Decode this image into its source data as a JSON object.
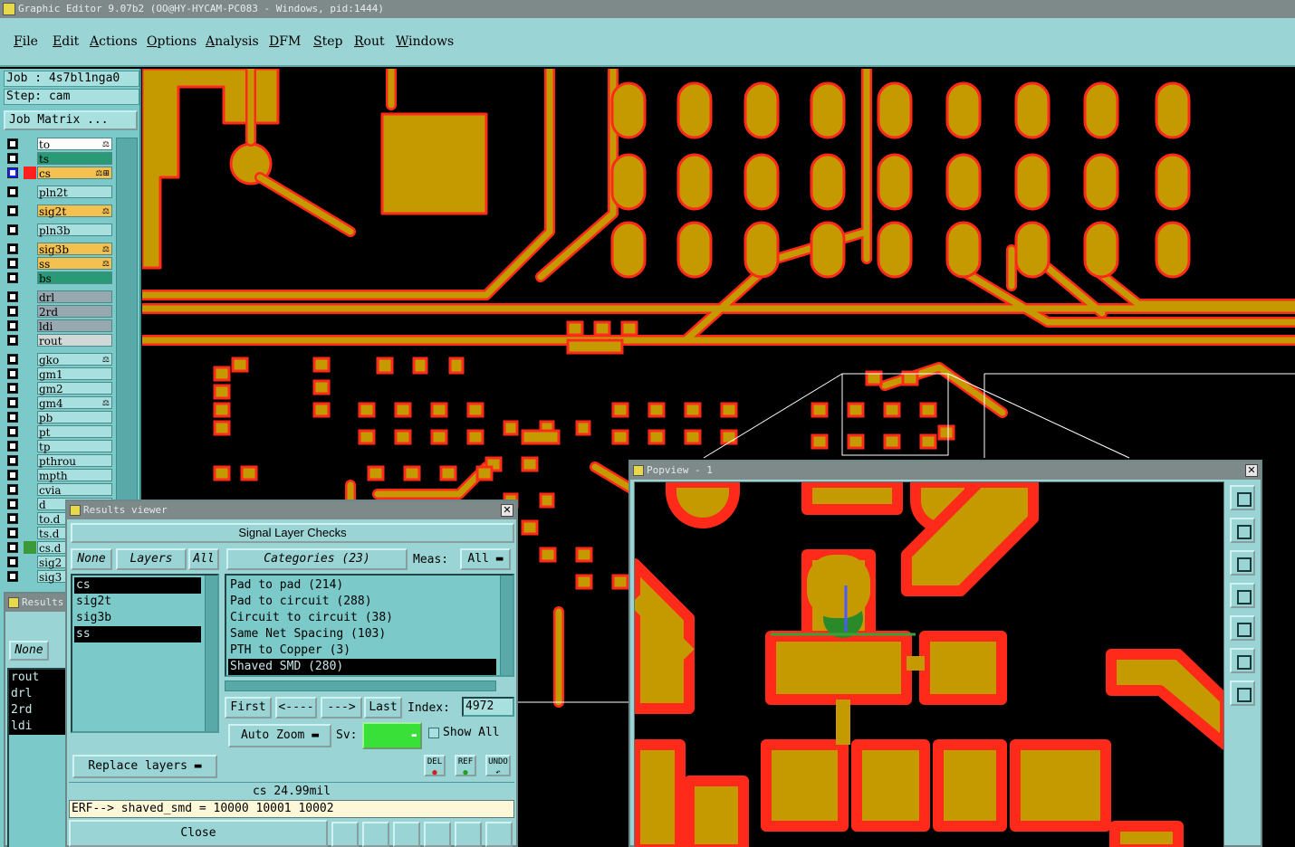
{
  "window": {
    "title": "Graphic Editor 9.07b2 (OO@HY-HYCAM-PC083 - Windows, pid:1444)"
  },
  "menu": [
    "File",
    "Edit",
    "Actions",
    "Options",
    "Analysis",
    "DFM",
    "Step",
    "Rout",
    "Windows"
  ],
  "job": {
    "job_label": "Job : 4s7bl1nga0",
    "step_label": "Step: cam",
    "matrix_button": "Job Matrix ..."
  },
  "layers": [
    {
      "name": "to",
      "color": "#ffffff",
      "icon": "⚖"
    },
    {
      "name": "ts",
      "color": "#2a9a76",
      "icon": ""
    },
    {
      "name": "cs",
      "color": "#f4c050",
      "icon": "⚖⊞",
      "active": true
    },
    {
      "name": "pln2t",
      "color": "#a8e0e0",
      "icon": ""
    },
    {
      "name": "sig2t",
      "color": "#f4c050",
      "icon": "⚖"
    },
    {
      "name": "pln3b",
      "color": "#a8e0e0",
      "icon": ""
    },
    {
      "name": "sig3b",
      "color": "#f4c050",
      "icon": "⚖"
    },
    {
      "name": "ss",
      "color": "#f4c050",
      "icon": "⚖"
    },
    {
      "name": "bs",
      "color": "#2a9a76",
      "icon": ""
    },
    {
      "name": "drl",
      "color": "#98a8b0",
      "icon": ""
    },
    {
      "name": "2rd",
      "color": "#98a8b0",
      "icon": ""
    },
    {
      "name": "ldi",
      "color": "#98a8b0",
      "icon": ""
    },
    {
      "name": "rout",
      "color": "#d0d8d8",
      "icon": ""
    },
    {
      "name": "gko",
      "color": "#a8e0e0",
      "icon": "⚖"
    },
    {
      "name": "gm1",
      "color": "#a8e0e0",
      "icon": ""
    },
    {
      "name": "gm2",
      "color": "#a8e0e0",
      "icon": ""
    },
    {
      "name": "gm4",
      "color": "#a8e0e0",
      "icon": "⚖"
    },
    {
      "name": "pb",
      "color": "#a8e0e0",
      "icon": ""
    },
    {
      "name": "pt",
      "color": "#a8e0e0",
      "icon": ""
    },
    {
      "name": "tp",
      "color": "#a8e0e0",
      "icon": ""
    },
    {
      "name": "pthrou",
      "color": "#a8e0e0",
      "icon": ""
    },
    {
      "name": "mpth",
      "color": "#a8e0e0",
      "icon": ""
    },
    {
      "name": "cvia",
      "color": "#a8e0e0",
      "icon": ""
    },
    {
      "name": "d",
      "color": "#a8e0e0",
      "icon": ""
    },
    {
      "name": "to.d",
      "color": "#a8e0e0",
      "icon": ""
    },
    {
      "name": "ts.d",
      "color": "#a8e0e0",
      "icon": ""
    },
    {
      "name": "cs.d",
      "color": "#a8e0e0",
      "icon": ""
    },
    {
      "name": "sig2",
      "color": "#a8e0e0",
      "icon": ""
    },
    {
      "name": "sig3",
      "color": "#a8e0e0",
      "icon": ""
    }
  ],
  "results_back": {
    "title": "Results",
    "none_button": "None",
    "layers": [
      "rout",
      "drl",
      "2rd",
      "ldi"
    ]
  },
  "results": {
    "title": "Results viewer",
    "heading": "Signal Layer Checks",
    "none_button": "None",
    "layers_button": "Layers",
    "all_button": "All",
    "categories_button": "Categories (23)",
    "meas_label": "Meas:",
    "meas_value": "All",
    "layers_list": [
      {
        "name": "cs",
        "selected": true
      },
      {
        "name": "sig2t",
        "selected": false
      },
      {
        "name": "sig3b",
        "selected": false
      },
      {
        "name": "ss",
        "selected": true
      }
    ],
    "categories": [
      {
        "name": "Pad to pad (214)",
        "selected": false
      },
      {
        "name": "Pad to circuit (288)",
        "selected": false
      },
      {
        "name": "Circuit to circuit (38)",
        "selected": false
      },
      {
        "name": "Same Net Spacing (103)",
        "selected": false
      },
      {
        "name": "PTH to Copper (3)",
        "selected": false
      },
      {
        "name": "Shaved SMD (280)",
        "selected": true
      }
    ],
    "nav": {
      "first": "First",
      "prev": "<----",
      "next": "--->",
      "last": "Last",
      "index_label": "Index:",
      "index_value": "4972"
    },
    "auto_zoom": "Auto Zoom",
    "sv_label": "Sv:",
    "show_all": "Show All",
    "replace_layers": "Replace layers",
    "del": "DEL",
    "ref": "REF",
    "undo": "UNDO",
    "status": "cs 24.99mil",
    "erf": "ERF--> shaved_smd = 10000 10001 10002",
    "close": "Close"
  },
  "popview": {
    "title": "Popview - 1"
  },
  "colors": {
    "copper": "#c49a00",
    "outline": "#ff2a1a",
    "panel": "#9ad4d4",
    "dark_panel": "#7cc9c9"
  }
}
